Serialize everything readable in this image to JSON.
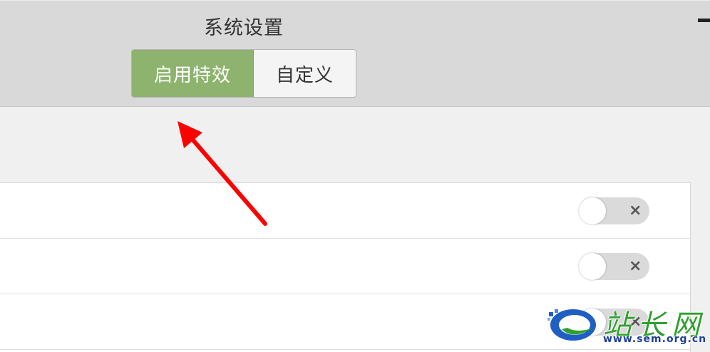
{
  "window": {
    "title": "系统设置"
  },
  "segmented": {
    "options": [
      {
        "label": "启用特效",
        "selected": true
      },
      {
        "label": "自定义",
        "selected": false
      }
    ]
  },
  "settings": {
    "rows": [
      {
        "toggle": false,
        "toggle_symbol": "×"
      },
      {
        "toggle": false,
        "toggle_symbol": "×"
      },
      {
        "toggle": false,
        "toggle_symbol": "×"
      }
    ]
  },
  "watermark": {
    "text": "站长网",
    "url": "www.sem.org.cn"
  },
  "colors": {
    "accent": "#8db36e",
    "annotation_arrow": "#ff0000",
    "header_bg": "#d9d9d9"
  }
}
